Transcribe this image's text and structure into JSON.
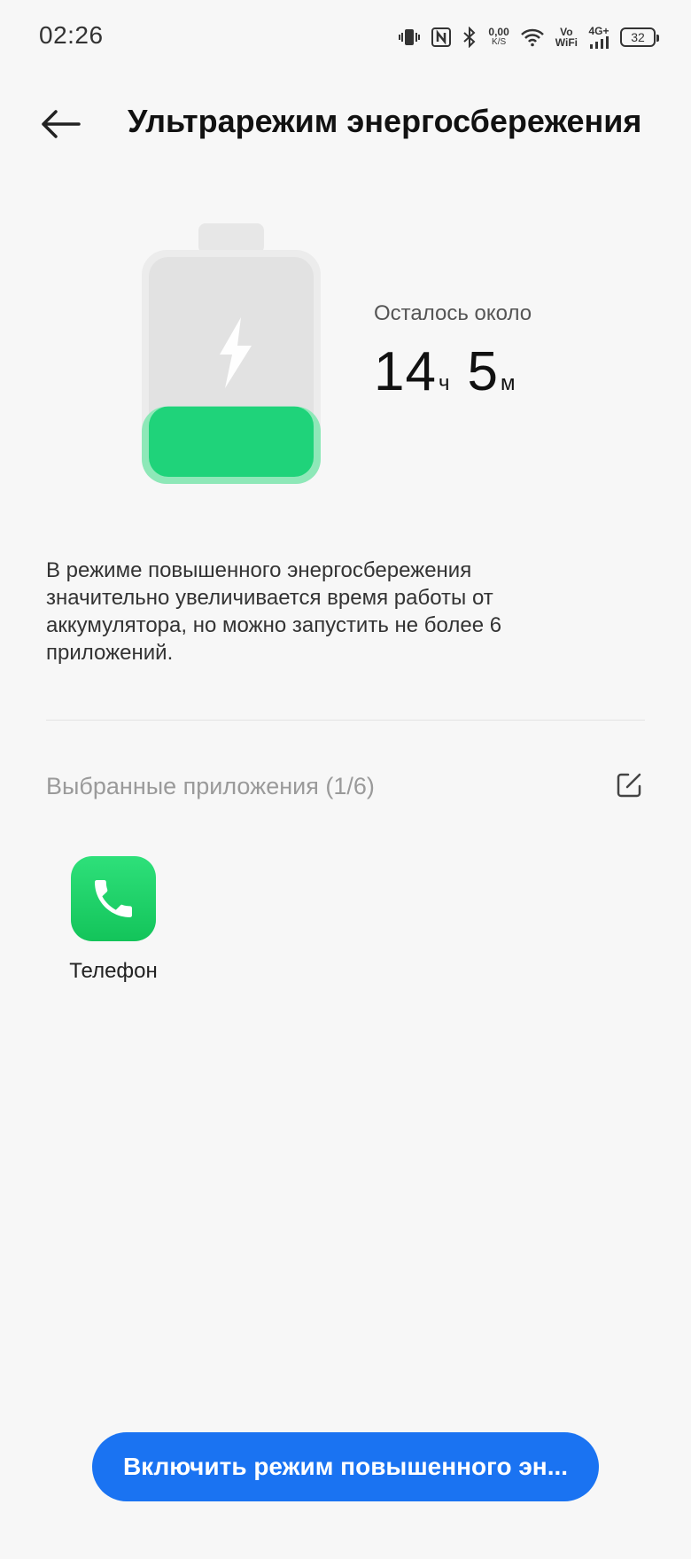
{
  "status_bar": {
    "time": "02:26",
    "net_speed_value": "0,00",
    "net_speed_unit": "K/S",
    "vowifi_top": "Vo",
    "vowifi_bottom": "WiFi",
    "network_type": "4G+",
    "battery_level": "32"
  },
  "header": {
    "title": "Ультрарежим энергосбережения"
  },
  "battery": {
    "remaining_label": "Осталось около",
    "hours": "14",
    "hours_unit": "ч",
    "minutes": "5",
    "minutes_unit": "м",
    "fill_level": 0.32,
    "fill_color": "#1fd37a"
  },
  "description": "В режиме повышенного энергосбережения значительно увеличивается время работы от аккумулятора, но можно запустить не более 6 приложений.",
  "selected_apps": {
    "title": "Выбранные приложения (1/6)",
    "apps": [
      {
        "label": "Телефон",
        "icon": "phone-icon",
        "color": "#1fd36b"
      }
    ]
  },
  "action_button": {
    "label": "Включить режим повышенного эн..."
  },
  "colors": {
    "accent": "#1a73f2",
    "background": "#f7f7f7"
  }
}
